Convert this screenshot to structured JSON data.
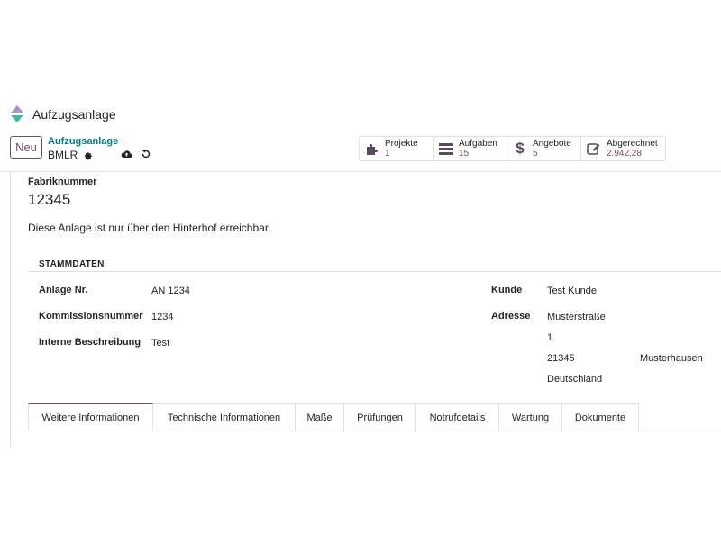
{
  "app": {
    "name": "Aufzugsanlage",
    "logo_icon": "app-logo-icon",
    "accent": "#714B67"
  },
  "controlpanel": {
    "new_label": "Neu",
    "breadcrumb_parent": "Aufzugsanlage",
    "breadcrumb_current": "BMLR"
  },
  "stats": [
    {
      "label": "Projekte",
      "value": "1",
      "icon": "puzzle-icon"
    },
    {
      "label": "Aufgaben",
      "value": "15",
      "icon": "tasks-icon"
    },
    {
      "label": "Angebote",
      "value": "5",
      "icon": "dollar-icon"
    },
    {
      "label": "Abgerechnet",
      "value": "2.942,28",
      "icon": "edit-icon"
    }
  ],
  "form": {
    "fabriknummer_label": "Fabriknummer",
    "fabriknummer_value": "12345",
    "note": "Diese Anlage ist nur über den Hinterhof erreichbar.",
    "section_title": "STAMMDATEN",
    "left_fields": [
      {
        "label": "Anlage Nr.",
        "value": "AN 1234"
      },
      {
        "label": "Kommissionsnummer",
        "value": "1234"
      },
      {
        "label": "Interne Beschreibung",
        "value": "Test"
      }
    ],
    "kunde_label": "Kunde",
    "kunde_value": "Test Kunde",
    "adresse_label": "Adresse",
    "address": {
      "street": "Musterstraße",
      "number": "1",
      "zip": "21345",
      "city": "Musterhausen",
      "country": "Deutschland"
    }
  },
  "tabs": [
    "Weitere Informationen",
    "Technische Informationen",
    "Maße",
    "Prüfungen",
    "Notrufdetails",
    "Wartung",
    "Dokumente"
  ]
}
